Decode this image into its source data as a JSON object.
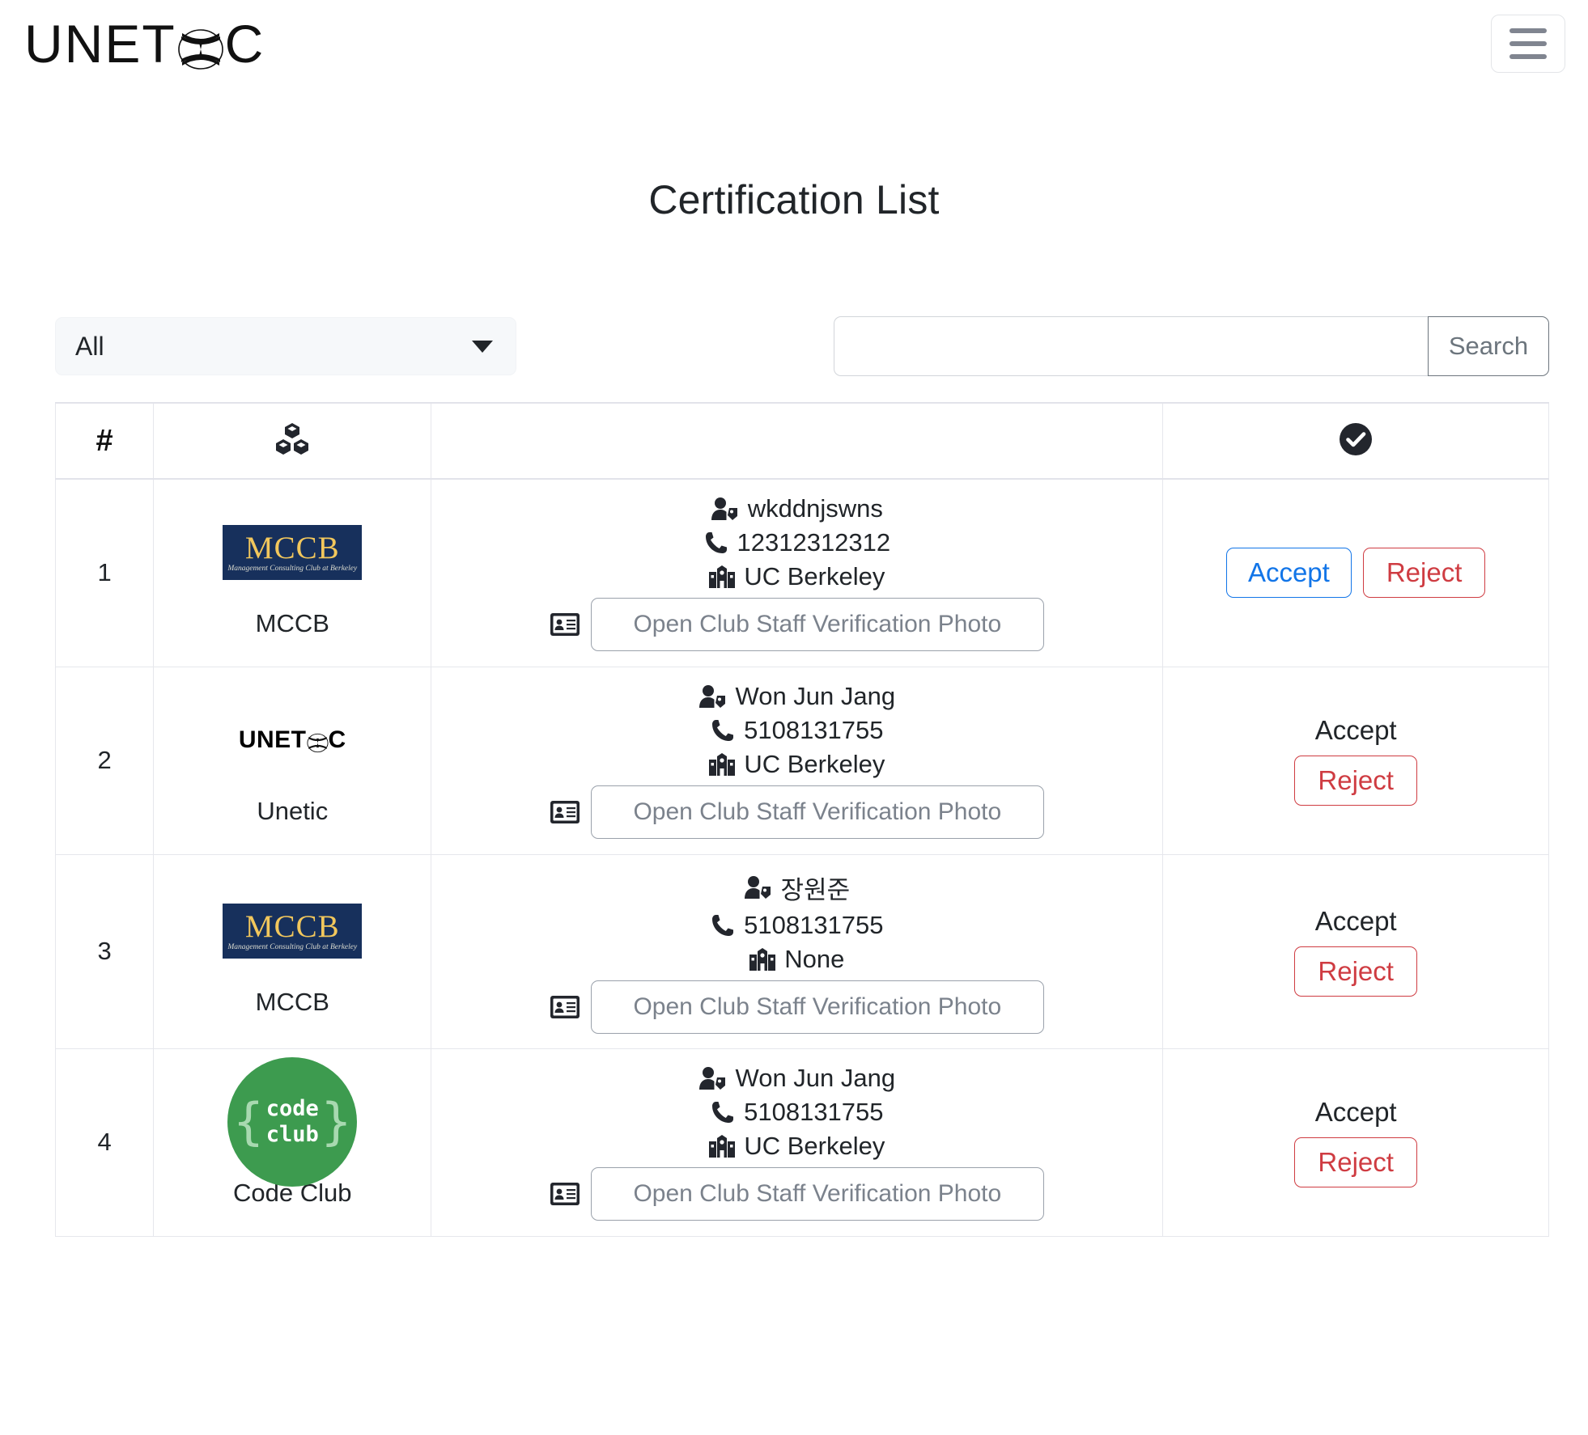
{
  "header": {
    "brand_prefix": "UNET",
    "brand_suffix": "C",
    "menu_label": "menu"
  },
  "page": {
    "title": "Certification List"
  },
  "controls": {
    "filter_value": "All",
    "search_value": "",
    "search_placeholder": "",
    "search_button": "Search"
  },
  "table": {
    "headers": {
      "index": "#",
      "club_icon": "cubes-icon",
      "info": "",
      "status_icon": "check-circle-icon"
    },
    "rows": [
      {
        "index": "1",
        "club_logo": "mccb",
        "club_name": "MCCB",
        "person": "wkddnjswns",
        "phone": "12312312312",
        "school": "UC Berkeley",
        "photo_button": "Open Club Staff Verification Photo",
        "accept_label": "Accept",
        "reject_label": "Reject",
        "accept_state": "button"
      },
      {
        "index": "2",
        "club_logo": "unetic",
        "club_name": "Unetic",
        "person": "Won Jun Jang",
        "phone": "5108131755",
        "school": "UC Berkeley",
        "photo_button": "Open Club Staff Verification Photo",
        "accept_label": "Accept",
        "reject_label": "Reject",
        "accept_state": "text"
      },
      {
        "index": "3",
        "club_logo": "mccb",
        "club_name": "MCCB",
        "person": "장원준",
        "phone": "5108131755",
        "school": "None",
        "photo_button": "Open Club Staff Verification Photo",
        "accept_label": "Accept",
        "reject_label": "Reject",
        "accept_state": "text"
      },
      {
        "index": "4",
        "club_logo": "codeclub",
        "club_name": "Code Club",
        "person": "Won Jun Jang",
        "phone": "5108131755",
        "school": "UC Berkeley",
        "photo_button": "Open Club Staff Verification Photo",
        "accept_label": "Accept",
        "reject_label": "Reject",
        "accept_state": "text"
      }
    ]
  },
  "logos": {
    "mccb_main": "MCCB",
    "mccb_sub": "Management Consulting Club at Berkeley",
    "unetic_prefix": "UNET",
    "unetic_suffix": "C",
    "codeclub_line1": "code",
    "codeclub_line2": "club",
    "codeclub_brace_left": "{",
    "codeclub_brace_right": "}"
  },
  "colors": {
    "accept": "#1275e8",
    "reject": "#cf3c42",
    "mccb_bg": "#17305c",
    "mccb_gold": "#f2c75c",
    "codeclub_green": "#3d9b4f"
  }
}
